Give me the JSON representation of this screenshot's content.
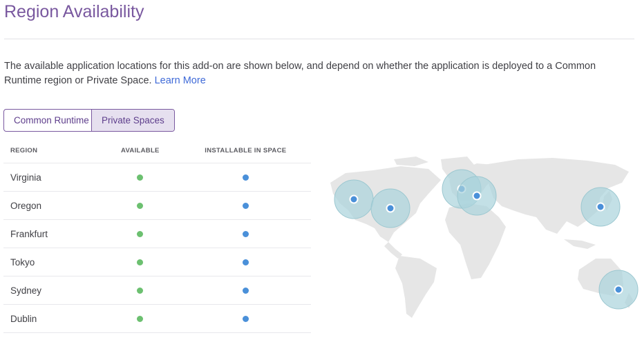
{
  "page": {
    "title": "Region Availability",
    "description": "The available application locations for this add-on are shown below, and depend on whether the application is deployed to a Common Runtime region or Private Space.",
    "learn_more": "Learn More"
  },
  "tabs": [
    {
      "label": "Common Runtime",
      "active": false
    },
    {
      "label": "Private Spaces",
      "active": true
    }
  ],
  "table": {
    "headers": [
      "REGION",
      "AVAILABLE",
      "INSTALLABLE IN SPACE"
    ],
    "rows": [
      {
        "region": "Virginia",
        "available": true,
        "installable": true
      },
      {
        "region": "Oregon",
        "available": true,
        "installable": true
      },
      {
        "region": "Frankfurt",
        "available": true,
        "installable": true
      },
      {
        "region": "Tokyo",
        "available": true,
        "installable": true
      },
      {
        "region": "Sydney",
        "available": true,
        "installable": true
      },
      {
        "region": "Dublin",
        "available": true,
        "installable": true
      }
    ]
  },
  "colors": {
    "available_dot": "#6cc070",
    "installable_dot": "#4a90d9",
    "accent": "#79589f",
    "map_land": "#e6e6e6",
    "map_halo": "#a9d3dc",
    "map_marker": "#4a90d9"
  },
  "map": {
    "markers": [
      "Oregon",
      "Virginia",
      "Dublin",
      "Frankfurt",
      "Tokyo",
      "Sydney"
    ]
  }
}
